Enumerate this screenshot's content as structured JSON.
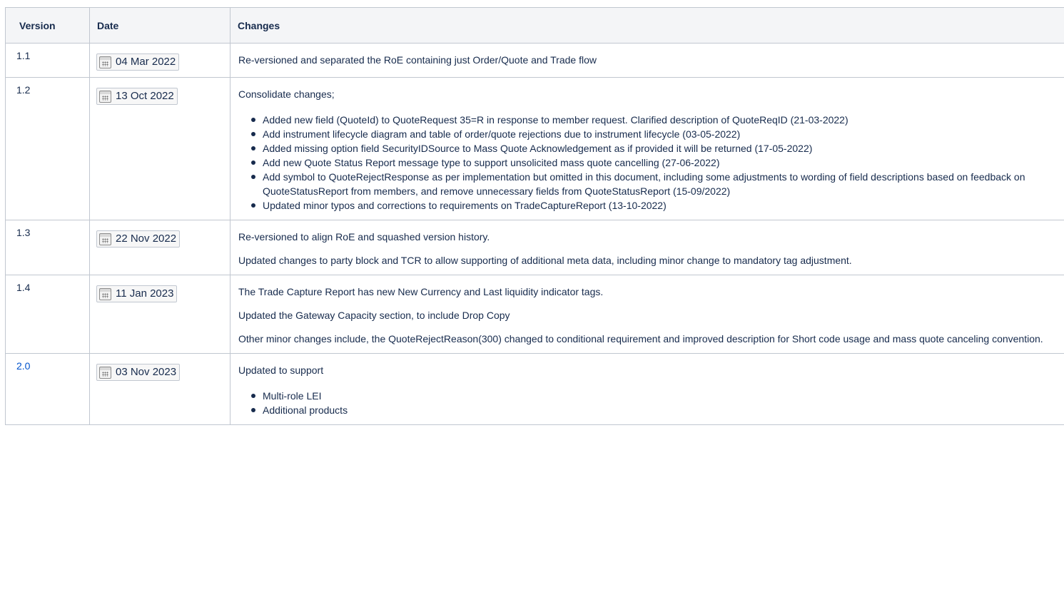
{
  "table": {
    "headers": {
      "version": "Version",
      "date": "Date",
      "changes": "Changes"
    },
    "rows": [
      {
        "version": "1.1",
        "date": "04 Mar 2022",
        "paragraphs": [
          "Re-versioned and separated the RoE containing just Order/Quote and Trade flow"
        ],
        "bullets": []
      },
      {
        "version": "1.2",
        "date": "13 Oct 2022",
        "paragraphs": [
          "Consolidate changes;"
        ],
        "bullets": [
          "Added new field (QuoteId) to QuoteRequest 35=R in response to member request. Clarified description of QuoteReqID (21-03-2022)",
          "Add instrument lifecycle diagram and table of order/quote rejections due to instrument lifecycle (03-05-2022)",
          "Added missing option field SecurityIDSource to Mass Quote Acknowledgement as if provided it will be returned (17-05-2022)",
          "Add new Quote Status Report message type to support unsolicited mass quote cancelling (27-06-2022)",
          "Add symbol to QuoteRejectResponse as per implementation but omitted in this document, including some adjustments to wording of field descriptions based on feedback on QuoteStatusReport from members, and remove unnecessary fields from QuoteStatusReport (15-09/2022)",
          "Updated minor typos and corrections to requirements on TradeCaptureReport (13-10-2022)"
        ]
      },
      {
        "version": "1.3",
        "date": "22 Nov 2022",
        "paragraphs": [
          "Re-versioned to align RoE and squashed version history.",
          "Updated changes to party block and TCR to allow supporting of additional meta data, including minor change to mandatory tag adjustment."
        ],
        "bullets": []
      },
      {
        "version": "1.4",
        "date": "11 Jan 2023",
        "paragraphs": [
          "The Trade Capture Report has new New Currency and Last liquidity indicator tags.",
          "Updated the Gateway Capacity section, to include Drop Copy",
          "Other minor changes include, the QuoteRejectReason(300) changed to conditional requirement and improved description for Short code usage and mass quote canceling convention."
        ],
        "bullets": []
      },
      {
        "version": "2.0",
        "date": "03 Nov 2023",
        "paragraphs": [
          "Updated to support"
        ],
        "bullets": [
          "Multi-role LEI",
          "Additional products"
        ]
      }
    ]
  }
}
